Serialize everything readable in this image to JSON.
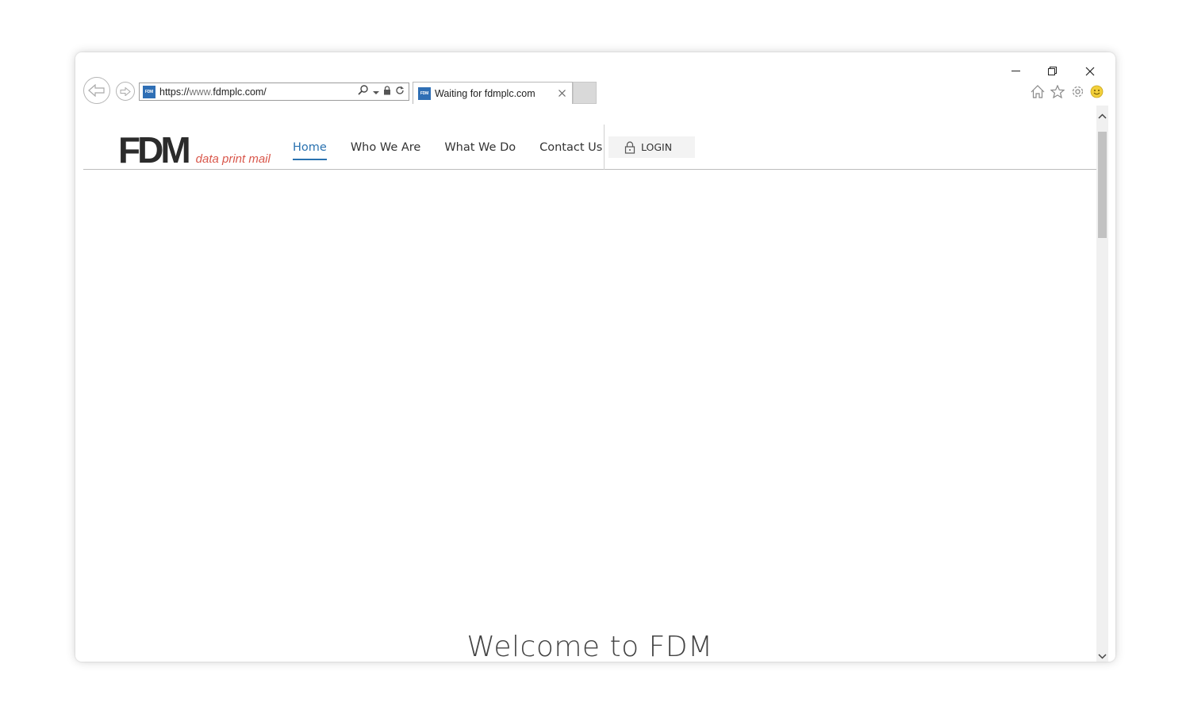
{
  "browser": {
    "address": {
      "url_host": "https://www.fdmplc.com/",
      "url_prefix": "https://",
      "url_dim": "www.",
      "url_main": "fdmplc.com/",
      "favicon_text": "FDM"
    },
    "tab": {
      "title": "Waiting for fdmplc.com",
      "favicon_text": "FDM"
    }
  },
  "site": {
    "logo": {
      "name": "FDM",
      "tagline": "data print mail",
      "tagline_color": "#d9574b"
    },
    "nav": {
      "items": [
        {
          "label": "Home",
          "active": true
        },
        {
          "label": "Who We Are",
          "active": false
        },
        {
          "label": "What We Do",
          "active": false
        },
        {
          "label": "Contact Us",
          "active": false
        }
      ],
      "accent": "#2a72b0"
    },
    "login": {
      "label": "LOGIN",
      "icon": "lock-icon"
    },
    "welcome": "Welcome to FDM"
  }
}
